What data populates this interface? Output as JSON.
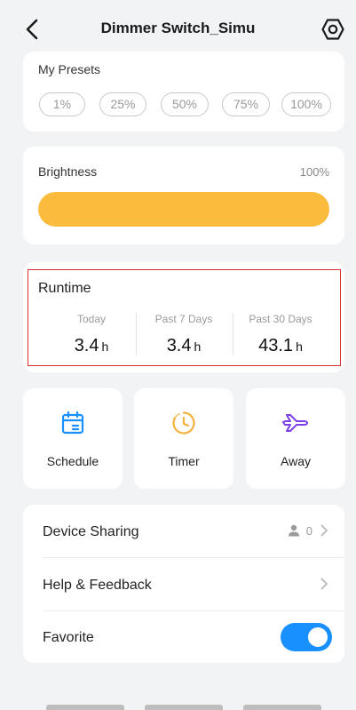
{
  "header": {
    "title": "Dimmer Switch_Simu"
  },
  "presets": {
    "label": "My Presets",
    "options": [
      "1%",
      "25%",
      "50%",
      "75%",
      "100%"
    ]
  },
  "brightness": {
    "label": "Brightness",
    "value_text": "100%",
    "level": 1.0
  },
  "runtime": {
    "label": "Runtime",
    "stats": [
      {
        "caption": "Today",
        "value": "3.4",
        "unit": "h"
      },
      {
        "caption": "Past 7 Days",
        "value": "3.4",
        "unit": "h"
      },
      {
        "caption": "Past 30 Days",
        "value": "43.1",
        "unit": "h"
      }
    ]
  },
  "actions": [
    {
      "label": "Schedule",
      "icon": "calendar-icon"
    },
    {
      "label": "Timer",
      "icon": "clock-icon"
    },
    {
      "label": "Away",
      "icon": "airplane-icon"
    }
  ],
  "list": {
    "device_sharing": {
      "label": "Device Sharing",
      "count": "0"
    },
    "help": {
      "label": "Help & Feedback"
    },
    "favorite": {
      "label": "Favorite",
      "enabled": true
    }
  },
  "colors": {
    "accent_yellow": "#fbbb3c",
    "accent_blue": "#1890ff",
    "airplane_purple": "#7b3fe4",
    "outline_red": "#d42f2f"
  }
}
